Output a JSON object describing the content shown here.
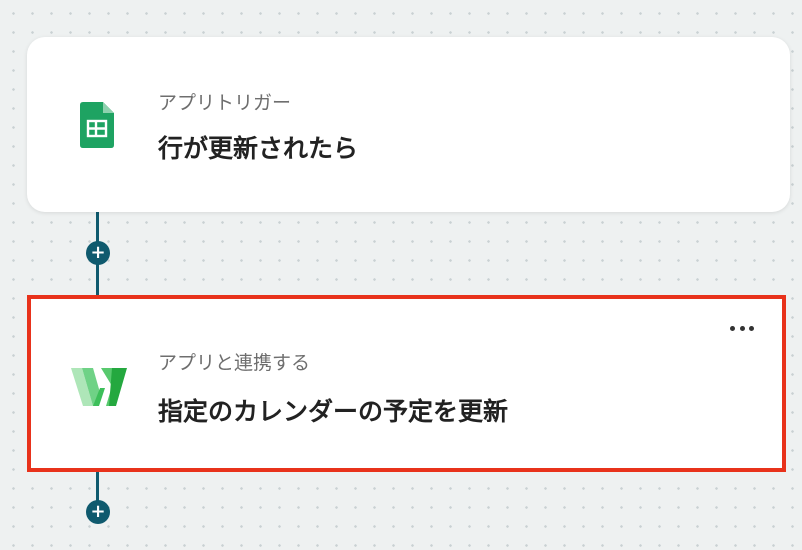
{
  "trigger": {
    "type_label": "アプリトリガー",
    "title": "行が更新されたら",
    "icon": "google-sheets-icon"
  },
  "action": {
    "type_label": "アプリと連携する",
    "title": "指定のカレンダーの予定を更新",
    "icon": "calendar-app-w-icon",
    "more_label": "…"
  },
  "add_step": {
    "label": "+"
  },
  "colors": {
    "connector": "#0f5a6e",
    "highlight": "#e8321b",
    "sheets_green": "#1ea362",
    "w_green": "#3dbf5a"
  }
}
